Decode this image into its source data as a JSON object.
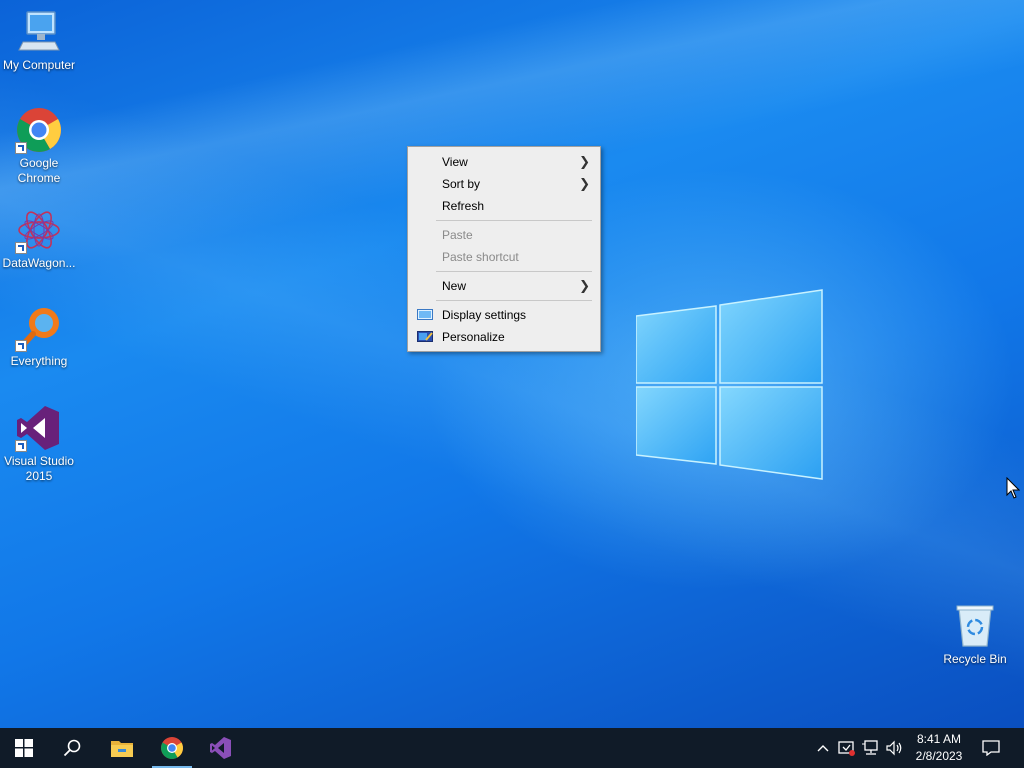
{
  "desktop": {
    "icons": [
      {
        "label": "My Computer",
        "name": "computer-icon"
      },
      {
        "label": "Google\nChrome",
        "name": "chrome-icon"
      },
      {
        "label": "DataWagon...",
        "name": "datawagon-icon"
      },
      {
        "label": "Everything",
        "name": "everything-icon"
      },
      {
        "label": "Visual Studio\n2015",
        "name": "visual-studio-icon"
      },
      {
        "label": "Recycle Bin",
        "name": "recycle-bin-icon"
      }
    ]
  },
  "context_menu": {
    "items": [
      {
        "label": "View",
        "submenu": true,
        "enabled": true
      },
      {
        "label": "Sort by",
        "submenu": true,
        "enabled": true
      },
      {
        "label": "Refresh",
        "submenu": false,
        "enabled": true
      },
      {
        "label": "Paste",
        "submenu": false,
        "enabled": false
      },
      {
        "label": "Paste shortcut",
        "submenu": false,
        "enabled": false
      },
      {
        "label": "New",
        "submenu": true,
        "enabled": true
      },
      {
        "label": "Display settings",
        "submenu": false,
        "enabled": true,
        "icon": "display-icon"
      },
      {
        "label": "Personalize",
        "submenu": false,
        "enabled": true,
        "icon": "personalize-icon"
      }
    ]
  },
  "taskbar": {
    "pinned": [
      "start-icon",
      "search-icon",
      "file-explorer-icon",
      "chrome-icon",
      "visual-studio-icon"
    ],
    "active_app": "chrome-icon",
    "tray_icons": [
      "chevron-up-icon",
      "security-alert-icon",
      "network-icon",
      "volume-icon"
    ],
    "time": "8:41 AM",
    "date": "2/8/2023"
  },
  "colors": {
    "taskbar_bg": "#101b28",
    "menu_bg": "#eeeeee",
    "desktop_blue": "#0b63d8"
  }
}
